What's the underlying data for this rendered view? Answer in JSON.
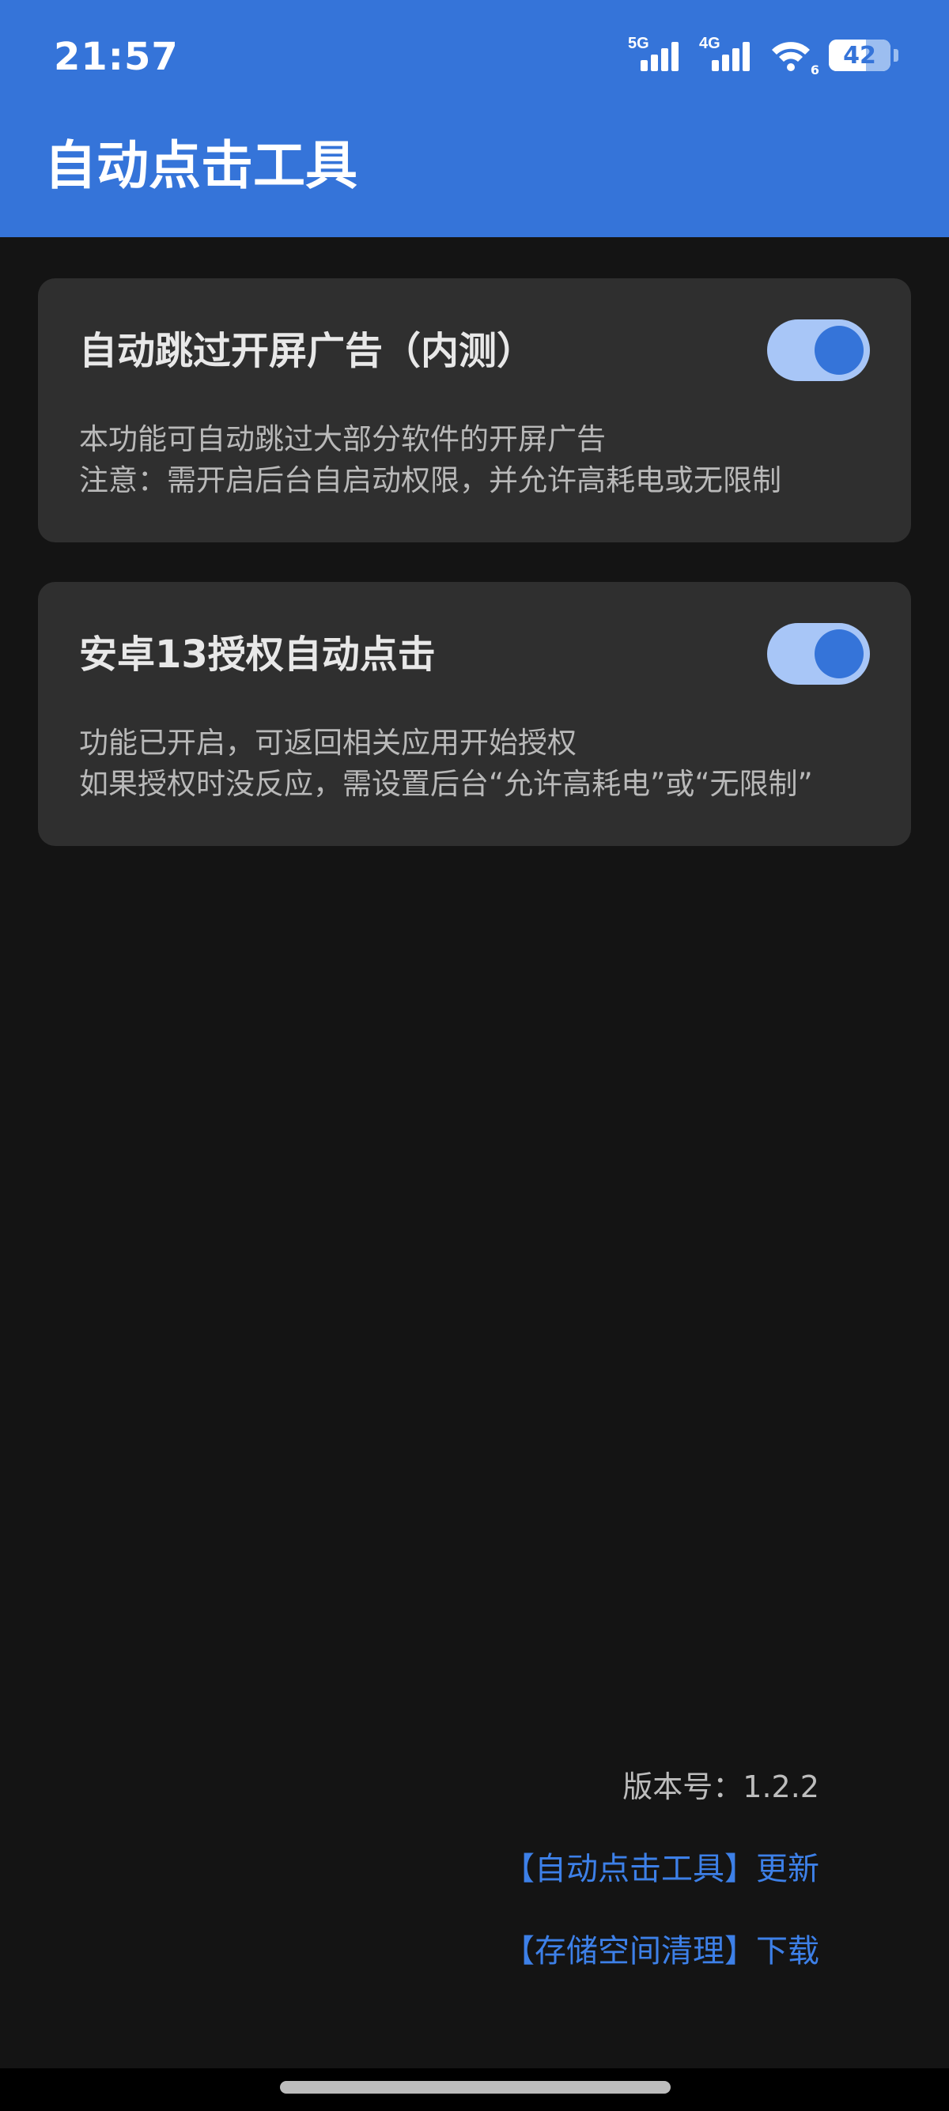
{
  "status_bar": {
    "time": "21:57",
    "network1": "5G",
    "network2": "4G",
    "wifi_badge": "6",
    "battery": "42"
  },
  "app": {
    "title": "自动点击工具"
  },
  "cards": [
    {
      "title": "自动跳过开屏广告（内测）",
      "enabled": true,
      "desc_line1": "本功能可自动跳过大部分软件的开屏广告",
      "desc_line2": "注意：需开启后台自启动权限，并允许高耗电或无限制"
    },
    {
      "title": "安卓13授权自动点击",
      "enabled": true,
      "desc_line1": "功能已开启，可返回相关应用开始授权",
      "desc_line2": "如果授权时没反应，需设置后台“允许高耗电”或“无限制”"
    }
  ],
  "footer": {
    "version": "版本号：1.2.2",
    "link_update": "【自动点击工具】更新",
    "link_download": "【存储空间清理】下载"
  },
  "colors": {
    "header": "#3574d9",
    "background": "#141414",
    "card": "#2f2f2f",
    "accent": "#3d80e8",
    "toggle_track": "#a8c6f7"
  }
}
